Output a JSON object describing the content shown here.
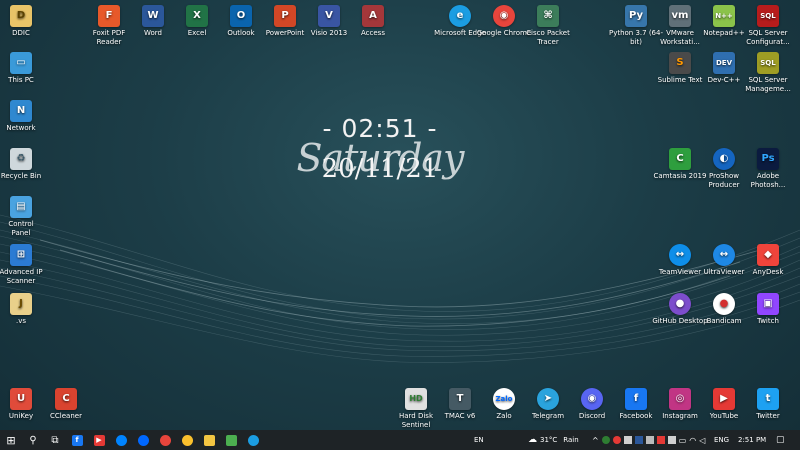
{
  "clock": {
    "time": "- 02:51 -",
    "day": "Saturday",
    "date": "20/11/21"
  },
  "icons": {
    "ddic": "DDIC",
    "this_pc": "This PC",
    "network": "Network",
    "recycle_bin": "Recycle Bin",
    "control_panel": "Control Panel",
    "advanced_ip": "Advanced IP Scanner",
    "vs": ".vs",
    "unikey": "UniKey",
    "ccleaner": "CCleaner",
    "foxit": "Foxit PDF Reader",
    "word": "Word",
    "excel": "Excel",
    "outlook": "Outlook",
    "powerpoint": "PowerPoint",
    "visio": "Visio 2013",
    "access": "Access",
    "edge": "Microsoft Edge",
    "chrome": "Google Chrome",
    "cisco": "Cisco Packet Tracer",
    "python": "Python 3.7 (64-bit)",
    "vmware": "VMware Workstati...",
    "notepadpp": "Notepad++",
    "sql_config": "SQL Server Configurat...",
    "sublime": "Sublime Text",
    "devcpp": "Dev-C++",
    "sql_mgmt": "SQL Server Manageme...",
    "camtasia": "Camtasia 2019",
    "proshow": "ProShow Producer",
    "photoshop": "Adobe Photosh...",
    "teamviewer": "TeamViewer",
    "ultraviewer": "UltraViewer",
    "anydesk": "AnyDesk",
    "github": "GitHub Desktop",
    "bandicam": "Bandicam",
    "twitch": "Twitch",
    "hdsentinel": "Hard Disk Sentinel",
    "tmac": "TMAC v6",
    "zalo": "Zalo",
    "telegram": "Telegram",
    "discord": "Discord",
    "facebook": "Facebook",
    "instagram": "Instagram",
    "youtube": "YouTube",
    "twitter": "Twitter"
  },
  "glyphs": {
    "zalo": "Zalo",
    "word": "W",
    "excel": "X",
    "outlook": "O",
    "powerpoint": "P",
    "visio": "V",
    "access": "A",
    "photoshop": "Ps",
    "devcpp": "DEV",
    "tmac": "T",
    "facebook": "f",
    "twitter": "t",
    "ccleaner": "C",
    "foxit": "F",
    "unikey": "U",
    "ddic": "D",
    "vs": "J",
    "notepad": "N++",
    "sublime": "S",
    "camtasia": "C",
    "python": "Py",
    "vmware": "vm",
    "sql": "SQL",
    "network": "N",
    "hdsentinel": "HD",
    "instagram": "◎",
    "youtube": "▶",
    "telegram": "➤",
    "discord": "◉",
    "github": "●",
    "bandicam": "●",
    "twitch": "▣",
    "teamviewer": "↔",
    "ultraviewer": "↔",
    "anydesk": "◆",
    "chrome": "◉",
    "edge": "e",
    "cisco": "⌘",
    "proshow": "◐",
    "controlpanel": "▤",
    "advancedip": "⊞",
    "recycle": "♻",
    "thispc": "▭"
  },
  "taskbar": {
    "lang_left": "EN",
    "weather_temp": "31°C",
    "weather_desc": "Rain",
    "lang": "ENG",
    "time": "2:51 PM",
    "start_glyph": "⊞",
    "search_glyph": "⚲",
    "taskview_glyph": "⧉"
  },
  "colors": {
    "word": "#2b579a",
    "excel": "#217346",
    "outlook": "#0a64ad",
    "powerpoint": "#d24726",
    "visio": "#3955a3",
    "access": "#a4373a",
    "foxit": "#e7592a",
    "edge": "#1b9de2",
    "chrome": "#e8453c",
    "photoshop": "#0b1b3f",
    "facebook": "#1877f2",
    "twitter": "#1da1f2",
    "youtube": "#e53935",
    "instagram": "#c13584",
    "discord": "#5865f2",
    "telegram": "#2aa3dd",
    "zalo": "#0068ff",
    "twitch": "#9146ff",
    "anydesk": "#ef443b",
    "teamviewer": "#0e8ee9",
    "ultraviewer": "#1e88e5",
    "camtasia": "#2e9e3e",
    "github": "#7c4dcc"
  }
}
